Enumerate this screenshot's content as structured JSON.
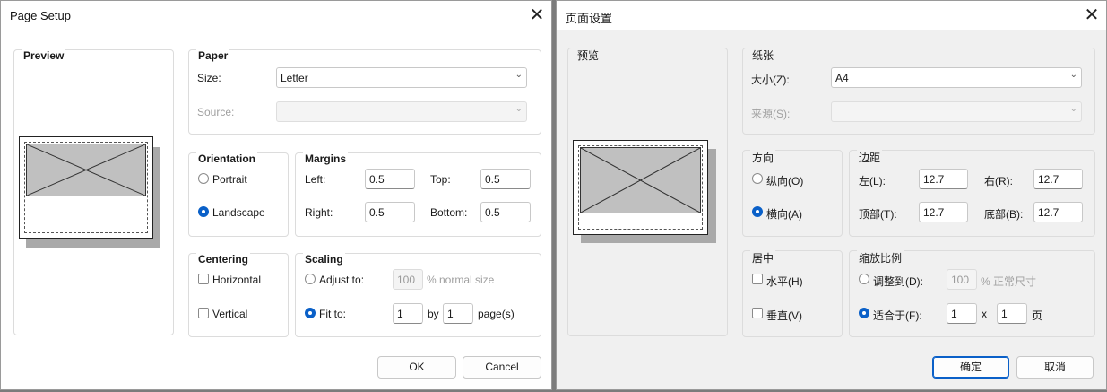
{
  "en": {
    "title": "Page Setup",
    "preview_label": "Preview",
    "paper": {
      "label": "Paper",
      "size_label": "Size:",
      "size_value": "Letter",
      "source_label": "Source:",
      "source_value": ""
    },
    "orientation": {
      "label": "Orientation",
      "portrait": "Portrait",
      "landscape": "Landscape",
      "selected": "landscape"
    },
    "margins": {
      "label": "Margins",
      "left_label": "Left:",
      "left": "0.5",
      "top_label": "Top:",
      "top": "0.5",
      "right_label": "Right:",
      "right": "0.5",
      "bottom_label": "Bottom:",
      "bottom": "0.5"
    },
    "centering": {
      "label": "Centering",
      "horizontal": "Horizontal",
      "vertical": "Vertical",
      "horizontal_checked": false,
      "vertical_checked": false
    },
    "scaling": {
      "label": "Scaling",
      "adjust_to": "Adjust to:",
      "adjust_value": "100",
      "normal_size": "% normal size",
      "fit_to": "Fit to:",
      "fit_wide": "1",
      "by": "by",
      "fit_tall": "1",
      "pages": "page(s)",
      "selected": "fit_to"
    },
    "ok": "OK",
    "cancel": "Cancel"
  },
  "zh": {
    "title": "页面设置",
    "preview_label": "预览",
    "paper": {
      "label": "纸张",
      "size_label": "大小(Z):",
      "size_value": "A4",
      "source_label": "来源(S):",
      "source_value": ""
    },
    "orientation": {
      "label": "方向",
      "portrait": "纵向(O)",
      "landscape": "横向(A)",
      "selected": "landscape"
    },
    "margins": {
      "label": "边距",
      "left_label": "左(L):",
      "left": "12.7",
      "top_label": "右(R):",
      "top": "12.7",
      "right_label": "顶部(T):",
      "right": "12.7",
      "bottom_label": "底部(B):",
      "bottom": "12.7"
    },
    "centering": {
      "label": "居中",
      "horizontal": "水平(H)",
      "vertical": "垂直(V)",
      "horizontal_checked": false,
      "vertical_checked": false
    },
    "scaling": {
      "label": "缩放比例",
      "adjust_to": "调整到(D):",
      "adjust_value": "100",
      "normal_size": "% 正常尺寸",
      "fit_to": "适合于(F):",
      "fit_wide": "1",
      "by": "x",
      "fit_tall": "1",
      "pages": "页",
      "selected": "fit_to"
    },
    "ok": "确定",
    "cancel": "取消"
  },
  "icons": {
    "close": "close-icon",
    "dropdown": "chevron-down-icon"
  },
  "colors": {
    "accent": "#0a60c8",
    "preview_fill": "#c0c0c0",
    "shadow": "#a9a9a9"
  }
}
